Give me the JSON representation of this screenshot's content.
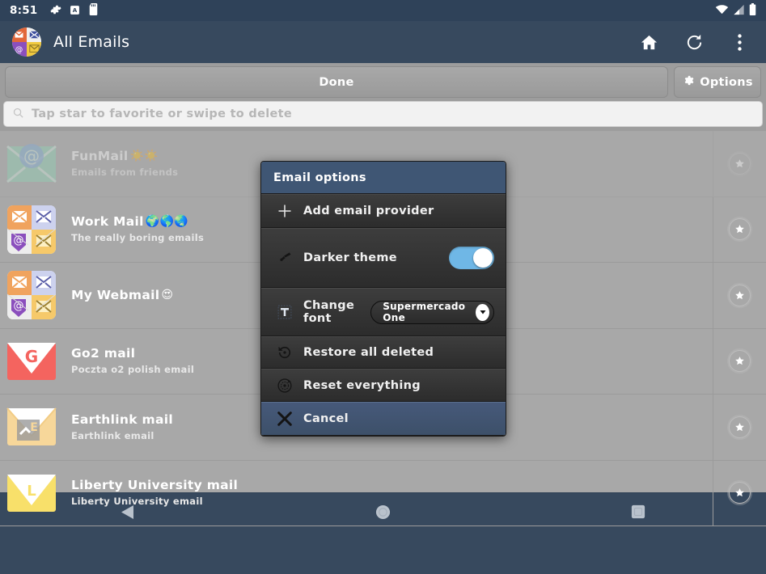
{
  "status_bar": {
    "time": "8:51",
    "left_icons": [
      "gear-icon",
      "a-badge-icon",
      "sd-card-icon"
    ],
    "right_icons": [
      "wifi-icon",
      "signal-icon",
      "battery-icon"
    ]
  },
  "app_bar": {
    "logo": "all-emails-logo",
    "title": "All Emails",
    "actions": [
      {
        "name": "home-icon",
        "label": "Home"
      },
      {
        "name": "refresh-icon",
        "label": "Refresh"
      },
      {
        "name": "overflow-menu-icon",
        "label": "More options"
      }
    ]
  },
  "toolbar": {
    "done_label": "Done",
    "options_label": "Options",
    "options_icon": "gear-icon"
  },
  "hint_bar": {
    "icon": "search-icon",
    "text": "Tap star to favorite or swipe to delete"
  },
  "email_list": {
    "rows": [
      {
        "title": "FunMail",
        "emoji": "☀️☀️",
        "subtitle": "Emails from friends",
        "icon": "envelope-at-icon",
        "ghost": true,
        "star": "star-icon"
      },
      {
        "title": "Work Mail",
        "emoji": "🌍🌎🌏",
        "subtitle": "The really boring emails",
        "icon": "mail-mosaic-icon",
        "ghost": false,
        "star": "star-icon"
      },
      {
        "title": "My Webmail",
        "emoji": "😍",
        "subtitle": "",
        "icon": "mail-mosaic-icon",
        "ghost": false,
        "star": "star-icon"
      },
      {
        "title": "Go2 mail",
        "emoji": "",
        "subtitle": "Poczta o2 polish email",
        "icon": "g-envelope-icon",
        "ghost": false,
        "star": "star-icon"
      },
      {
        "title": "Earthlink mail",
        "emoji": "",
        "subtitle": "Earthlink email",
        "icon": "earthlink-envelope-icon",
        "ghost": false,
        "star": "star-icon"
      },
      {
        "title": "Liberty University mail",
        "emoji": "",
        "subtitle": "Liberty University email",
        "icon": "liberty-envelope-icon",
        "ghost": false,
        "star": "star-icon"
      }
    ]
  },
  "dialog": {
    "title": "Email options",
    "add_provider": {
      "label": "Add email provider",
      "icon": "plus-icon"
    },
    "darker_theme": {
      "label": "Darker theme",
      "icon": "paint-roller-icon",
      "enabled": true
    },
    "change_font": {
      "label": "Change font",
      "icon": "text-cursor-icon",
      "value": "Supermercado One",
      "chevron": "chevron-down-icon"
    },
    "restore_all": {
      "label": "Restore all deleted",
      "icon": "restore-icon"
    },
    "reset_everything": {
      "label": "Reset everything",
      "icon": "reset-icon"
    },
    "cancel": {
      "label": "Cancel",
      "icon": "close-icon"
    }
  },
  "nav_bar": {
    "back": "back-triangle-icon",
    "home": "home-circle-icon",
    "recents": "recents-square-icon"
  },
  "colors": {
    "app_bar": "#37495e",
    "status_bar": "#2f4259",
    "list_bg": "#a8a8a8",
    "toolbar_bg": "#9d9d9d",
    "dialog_header": "#3f5674",
    "dialog_body": "#343434",
    "accent_toggle": "#6fb7e6",
    "cancel_row": "#41547180"
  }
}
